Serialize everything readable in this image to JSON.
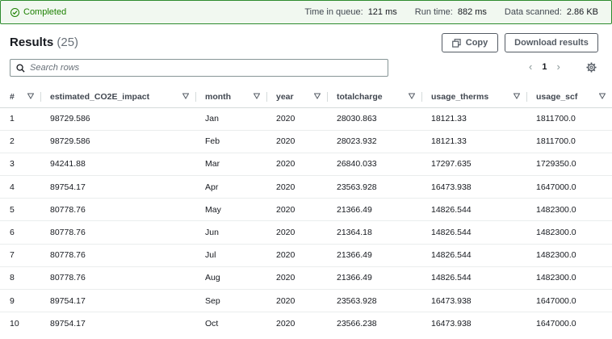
{
  "status": {
    "label": "Completed",
    "queue_label": "Time in queue:",
    "queue_value": "121 ms",
    "run_label": "Run time:",
    "run_value": "882 ms",
    "scanned_label": "Data scanned:",
    "scanned_value": "2.86 KB"
  },
  "results": {
    "title": "Results",
    "count": "(25)",
    "copy_label": "Copy",
    "download_label": "Download results",
    "search_placeholder": "Search rows",
    "page": "1"
  },
  "table": {
    "columns": [
      "#",
      "estimated_CO2E_impact",
      "month",
      "year",
      "totalcharge",
      "usage_therms",
      "usage_scf"
    ],
    "rows": [
      [
        "1",
        "98729.586",
        "Jan",
        "2020",
        "28030.863",
        "18121.33",
        "1811700.0"
      ],
      [
        "2",
        "98729.586",
        "Feb",
        "2020",
        "28023.932",
        "18121.33",
        "1811700.0"
      ],
      [
        "3",
        "94241.88",
        "Mar",
        "2020",
        "26840.033",
        "17297.635",
        "1729350.0"
      ],
      [
        "4",
        "89754.17",
        "Apr",
        "2020",
        "23563.928",
        "16473.938",
        "1647000.0"
      ],
      [
        "5",
        "80778.76",
        "May",
        "2020",
        "21366.49",
        "14826.544",
        "1482300.0"
      ],
      [
        "6",
        "80778.76",
        "Jun",
        "2020",
        "21364.18",
        "14826.544",
        "1482300.0"
      ],
      [
        "7",
        "80778.76",
        "Jul",
        "2020",
        "21366.49",
        "14826.544",
        "1482300.0"
      ],
      [
        "8",
        "80778.76",
        "Aug",
        "2020",
        "21366.49",
        "14826.544",
        "1482300.0"
      ],
      [
        "9",
        "89754.17",
        "Sep",
        "2020",
        "23563.928",
        "16473.938",
        "1647000.0"
      ],
      [
        "10",
        "89754.17",
        "Oct",
        "2020",
        "23566.238",
        "16473.938",
        "1647000.0"
      ]
    ]
  },
  "icons": {
    "status": "check-circle-icon",
    "copy": "copy-icon",
    "search": "search-icon",
    "prev": "chevron-left-icon",
    "next": "chevron-right-icon",
    "settings": "gear-icon",
    "sort": "caret-down-icon"
  },
  "colors": {
    "success": "#1d8102",
    "status_bg": "#f1f8f0",
    "border": "#d5dbdb"
  }
}
